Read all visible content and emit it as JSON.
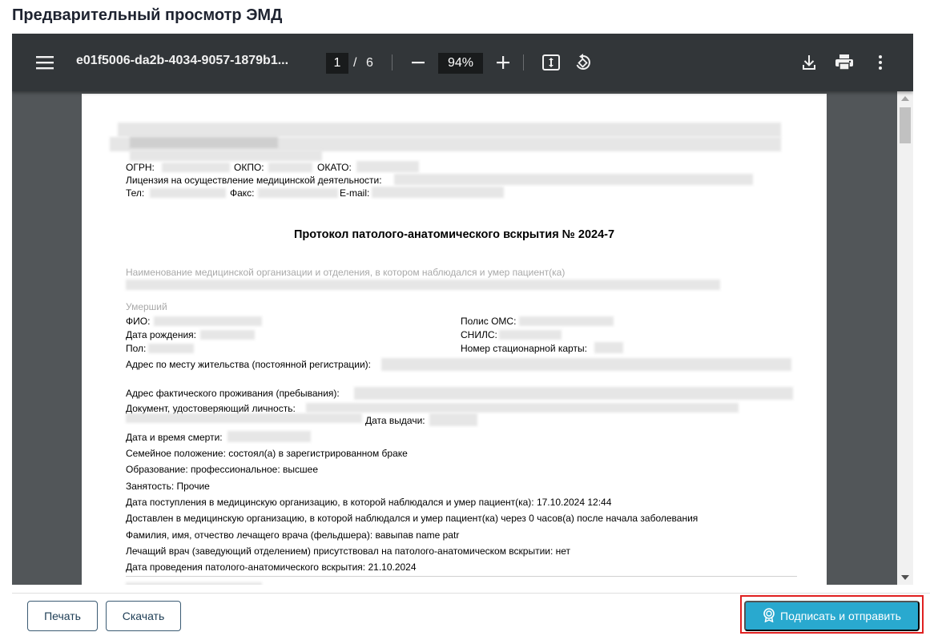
{
  "page": {
    "title": "Предварительный просмотр ЭМД"
  },
  "viewer": {
    "doc_name": "e01f5006-da2b-4034-9057-1879b1...",
    "current_page": "1",
    "page_separator": "/",
    "total_pages": "6",
    "zoom": "94%",
    "icons": [
      "menu-icon",
      "zoom-out-icon",
      "zoom-in-icon",
      "fit-page-icon",
      "rotate-icon",
      "download-icon",
      "print-icon",
      "more-vert-icon"
    ]
  },
  "document": {
    "header": {
      "ogrn_label": "ОГРН:",
      "okpo_label": "ОКПО:",
      "okato_label": "ОКАТО:",
      "license_label": "Лицензия на осуществление медицинской деятельности:",
      "phone_label": "Тел:",
      "fax_label": "Факс:",
      "email_label": "E-mail:"
    },
    "title": "Протокол патолого-анатомического вскрытия № 2024-7",
    "org_section_label": "Наименование медицинской организации и отделения, в котором наблюдался и умер пациент(ка)",
    "deceased_section_label": "Умерший",
    "fio_label": "ФИО:",
    "birth_date_label": "Дата рождения:",
    "sex_label": "Пол:",
    "oms_label": "Полис ОМС:",
    "snils_label": "СНИЛС:",
    "card_label": "Номер стационарной карты:",
    "reg_address_label": "Адрес по месту жительства (постоянной регистрации):",
    "actual_address_label": "Адрес фактического проживания (пребывания):",
    "id_doc_label": "Документ, удостоверяющий личность:",
    "issue_date_label": "Дата выдачи:",
    "death_datetime_label": "Дата и время смерти:",
    "marital": "Семейное положение: состоял(а) в зарегистрированном браке",
    "education": "Образование: профессиональное: высшее",
    "employment": "Занятость: Прочие",
    "admission": "Дата поступления в медицинскую организацию, в которой наблюдался и умер пациент(ка): 17.10.2024 12:44",
    "delivered": "Доставлен в медицинскую организацию, в которой наблюдался и умер пациент(ка) через 0 часов(а) после начала заболевания",
    "doctor_name": "Фамилия, имя, отчество лечащего врача (фельдшера): вавыпав name patr",
    "doctor_present": "Лечащий врач (заведующий отделением) присутствовал на патолого-анатомическом вскрытии: нет",
    "autopsy_date": "Дата проведения патолого-анатомического вскрытия: 21.10.2024"
  },
  "actions": {
    "print_label": "Печать",
    "download_label": "Скачать",
    "sign_send_label": "Подписать и отправить",
    "sign_icon": "certificate-badge-icon",
    "highlight_color": "#e02020",
    "primary_color": "#29a9cf"
  }
}
